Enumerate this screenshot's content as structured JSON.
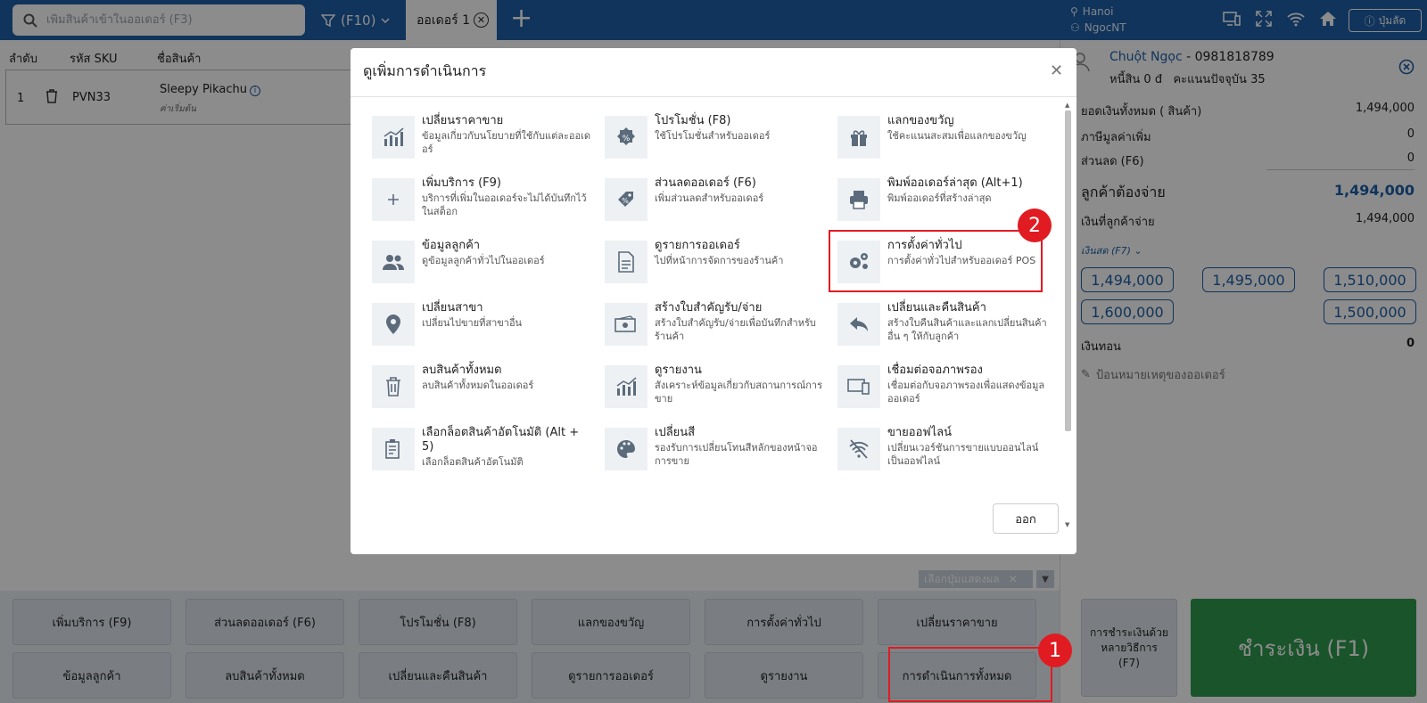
{
  "topbar": {
    "search_placeholder": "เพิ่มสินค้าเข้าในออเดอร์ (F3)",
    "f10_label": "(F10)",
    "order_tab_label": "ออเดอร์ 1",
    "location": "Hanoi",
    "user": "NgocNT",
    "shortcut_label": "ปุ่มลัด"
  },
  "table": {
    "headers": [
      "ลำดับ",
      "รหัส SKU",
      "ชื่อสินค้า"
    ],
    "rows": [
      {
        "no": "1",
        "sku": "PVN33",
        "name": "Sleepy Pikachu",
        "sub": "ค่าเริ่มต้น"
      }
    ]
  },
  "modal": {
    "title": "ดูเพิ่มการดำเนินการ",
    "items": [
      {
        "title": "เปลี่ยนราคาขาย",
        "desc": "ข้อมูลเกี่ยวกับนโยบายที่ใช้กับแต่ละออเดอร์",
        "icon": "bar-chart-icon"
      },
      {
        "title": "โปรโมชั่น (F8)",
        "desc": "ใช้โปรโมชั่นสำหรับออเดอร์",
        "icon": "promotion-badge-icon"
      },
      {
        "title": "แลกของขวัญ",
        "desc": "ใช้คะแนนสะสมเพื่อแลกของขวัญ",
        "icon": "gift-icon"
      },
      {
        "title": "เพิ่มบริการ (F9)",
        "desc": "บริการที่เพิ่มในออเดอร์จะไม่ได้บันทึกไว้ในสต็อก",
        "icon": "plus-icon"
      },
      {
        "title": "ส่วนลดออเดอร์ (F6)",
        "desc": "เพิ่มส่วนลดสำหรับออเดอร์",
        "icon": "discount-tag-icon"
      },
      {
        "title": "พิมพ์ออเดอร์ล่าสุด (Alt+1)",
        "desc": "พิมพ์ออเดอร์ที่สร้างล่าสุด",
        "icon": "printer-icon"
      },
      {
        "title": "ข้อมูลลูกค้า",
        "desc": "ดูข้อมูลลูกค้าทั่วไปในออเดอร์",
        "icon": "users-icon"
      },
      {
        "title": "ดูรายการออเดอร์",
        "desc": "ไปที่หน้าการจัดการของร้านค้า",
        "icon": "document-icon"
      },
      {
        "title": "การตั้งค่าทั่วไป",
        "desc": "การตั้งค่าทั่วไปสำหรับออเดอร์ POS",
        "icon": "gears-icon"
      },
      {
        "title": "เปลี่ยนสาขา",
        "desc": "เปลี่ยนไปขายที่สาขาอื่น",
        "icon": "location-pin-icon"
      },
      {
        "title": "สร้างใบสำคัญรับ/จ่าย",
        "desc": "สร้างใบสำคัญรับ/จ่ายเพื่อบันทึกสำหรับร้านค้า",
        "icon": "cash-icon"
      },
      {
        "title": "เปลี่ยนและคืนสินค้า",
        "desc": "สร้างใบคืนสินค้าและแลกเปลี่ยนสินค้าอื่น ๆ ให้กับลูกค้า",
        "icon": "reply-arrow-icon"
      },
      {
        "title": "ลบสินค้าทั้งหมด",
        "desc": "ลบสินค้าทั้งหมดในออเดอร์",
        "icon": "trash-icon"
      },
      {
        "title": "ดูรายงาน",
        "desc": "สังเคราะห์ข้อมูลเกี่ยวกับสถานการณ์การขาย",
        "icon": "report-chart-icon"
      },
      {
        "title": "เชื่อมต่อจอภาพรอง",
        "desc": "เชื่อมต่อกับจอภาพรองเพื่อแสดงข้อมูลออเดอร์",
        "icon": "second-screen-icon"
      },
      {
        "title": "เลือกล็อตสินค้าอัตโนมัติ (Alt + 5)",
        "desc": "เลือกล็อตสินค้าอัตโนมัติ",
        "icon": "lot-icon"
      },
      {
        "title": "เปลี่ยนสี",
        "desc": "รองรับการเปลี่ยนโทนสีหลักของหน้าจอการขาย",
        "icon": "palette-icon"
      },
      {
        "title": "ขายออฟไลน์",
        "desc": "เปลี่ยนเวอร์ชันการขายแบบออนไลน์เป็นออฟไลน์",
        "icon": "wifi-off-icon"
      }
    ],
    "exit_label": "ออก"
  },
  "filter": {
    "chip_label": "เลือกปุ่มแสดงผล"
  },
  "bottom_buttons": [
    "เพิ่มบริการ (F9)",
    "ส่วนลดออเดอร์ (F6)",
    "โปรโมชั่น (F8)",
    "แลกของขวัญ",
    "การตั้งค่าทั่วไป",
    "เปลี่ยนราคาขาย",
    "ข้อมูลลูกค้า",
    "ลบสินค้าทั้งหมด",
    "เปลี่ยนและคืนสินค้า",
    "ดูรายการออเดอร์",
    "ดูรายงาน",
    "การดำเนินการทั้งหมด"
  ],
  "customer": {
    "name": "Chuột Ngọc",
    "phone": " - 0981818789",
    "debt": "หนี้สิน 0 đ",
    "points": "คะแนนปัจจุบัน 35"
  },
  "summary": {
    "total_goods_label": "ยอดเงินทั้งหมด ( สินค้า)",
    "total_goods": "1,494,000",
    "vat_label": "ภาษีมูลค่าเพิ่ม",
    "vat": "0",
    "discount_label": "ส่วนลด (F6)",
    "discount": "0",
    "to_pay_label": "ลูกค้าต้องจ่าย",
    "to_pay": "1,494,000",
    "paid_label": "เงินที่ลูกค้าจ่าย",
    "paid": "1,494,000",
    "cash_type": "เงินสด (F7)",
    "quick_amounts": [
      "1,494,000",
      "1,495,000",
      "1,510,000",
      "1,600,000",
      "1,500,000"
    ],
    "change_label": "เงินทอน",
    "change": "0",
    "note_placeholder": "ป้อนหมายเหตุของออเดอร์"
  },
  "payment": {
    "multi_label": "การชำระเงินด้วยหลายวิธีการ (F7)",
    "pay_label": "ชำระเงิน (F1)"
  },
  "annotations": [
    "1",
    "2"
  ],
  "colors": {
    "primary": "#1e5fa8",
    "pay_green": "#2e9a4e",
    "annotation_red": "#e11b22"
  }
}
